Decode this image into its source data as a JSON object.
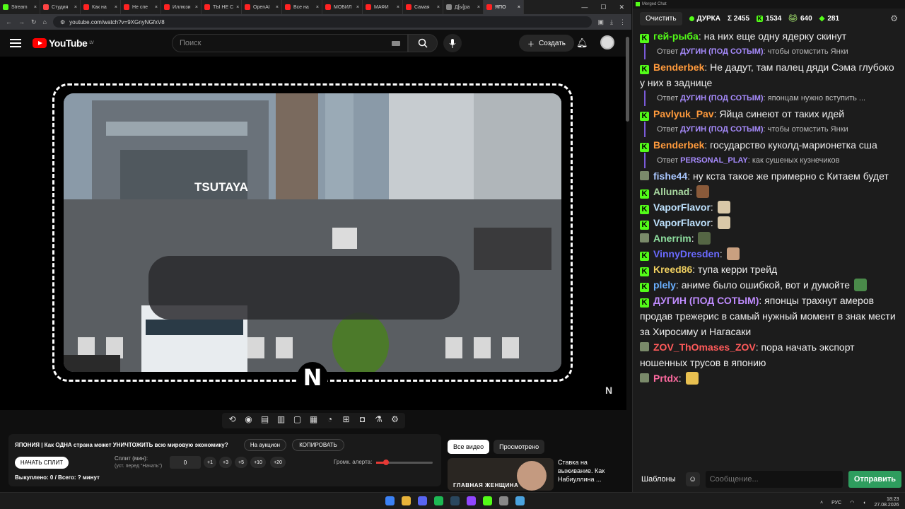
{
  "tabs": [
    {
      "label": "Stream",
      "color": "#53fc18"
    },
    {
      "label": "Студия",
      "color": "#ff4444"
    },
    {
      "label": "Как на",
      "color": "#ff2222"
    },
    {
      "label": "Не спе",
      "color": "#ff2222"
    },
    {
      "label": "Иллюзи",
      "color": "#ff2222"
    },
    {
      "label": "ТЫ НЕ С",
      "color": "#ff2222"
    },
    {
      "label": "OpenAI",
      "color": "#ff2222"
    },
    {
      "label": "Все на",
      "color": "#ff2222"
    },
    {
      "label": "МОБИЛ",
      "color": "#ff2222"
    },
    {
      "label": "МАФИ",
      "color": "#ff2222"
    },
    {
      "label": "Самая",
      "color": "#ff2222"
    },
    {
      "label": "Д[ы]ра",
      "color": "#888888"
    },
    {
      "label": "ЯПО",
      "color": "#ff2222"
    }
  ],
  "browser": {
    "url": "youtube.com/watch?v=9XGnyNGfxV8"
  },
  "youtube": {
    "logo": "YouTube",
    "region": "LV",
    "search_placeholder": "Поиск",
    "create_label": "Создать"
  },
  "player": {
    "channel_mark": "N"
  },
  "panel": {
    "title": "ЯПОНИЯ | Как ОДНА страна может УНИЧТОЖИТЬ всю мировую экономику?",
    "auction_label": "На аукцион",
    "copy_label": "КОПИРОВАТЬ",
    "start_split_label": "НАЧАТЬ СПЛИТ",
    "split_label": "Сплит (мин):",
    "split_hint": "(уст. перед \"Начать\")",
    "split_value": "0",
    "steps": [
      "+1",
      "+3",
      "+5",
      "+10",
      "+20"
    ],
    "volume_label": "Громк. алерта:",
    "volume_level": 0.17,
    "bought": "Выкуплено: 0 / Всего: ? минут"
  },
  "reco": {
    "tab_all": "Все видео",
    "tab_watched": "Просмотрено",
    "title": "Ставка на выживание. Как Набиуллина ...",
    "thumb_text": "ГЛАВНАЯ ЖЕНЩИНА"
  },
  "chat": {
    "window_title": "Merged Chat",
    "clear_label": "Очистить",
    "streamer": "ДУРКА",
    "total": "Σ 2455",
    "kick_count": "1534",
    "twitch_count": "640",
    "other_count": "281",
    "reply_prefix": "Ответ",
    "templates_label": "Шаблоны",
    "input_placeholder": "Сообщение...",
    "send_label": "Отправить",
    "messages": [
      {
        "type": "msg",
        "user": "гей-рыба",
        "color": "#53fc18",
        "text": "на них еще одну ядерку скинут"
      },
      {
        "type": "reply",
        "user": "ДУГИН (ПОД СОТЫМ)",
        "text": "чтобы отомстить Янки"
      },
      {
        "type": "msg",
        "user": "Benderbek",
        "color": "#ff9a3c",
        "text": "Не дадут, там палец дяди Сэма глубоко у них в заднице"
      },
      {
        "type": "reply",
        "user": "ДУГИН (ПОД СОТЫМ)",
        "text": "японцам нужно вступить ..."
      },
      {
        "type": "msg",
        "user": "Pavlyuk_Pav",
        "color": "#ff9a3c",
        "text": "Яйца синеют от таких идей"
      },
      {
        "type": "reply",
        "user": "ДУГИН (ПОД СОТЫМ)",
        "text": "чтобы отомстить Янки"
      },
      {
        "type": "msg",
        "user": "Benderbek",
        "color": "#ff9a3c",
        "text": "государство куколд-марионетка сша"
      },
      {
        "type": "reply",
        "user": "PERSONAL_PLAY",
        "text": "как сушеных кузнечиков"
      },
      {
        "type": "msg",
        "user": "fishe44",
        "color": "#a9c7ff",
        "text": "ну кста такое же примерно с Китаем будет",
        "img": true
      },
      {
        "type": "msg",
        "user": "Allunad",
        "color": "#a8d8a0",
        "text": "",
        "emote": "#8a5a3a"
      },
      {
        "type": "msg",
        "user": "VaporFlavor",
        "color": "#bfe3ff",
        "text": "",
        "emote": "#d9c8a8"
      },
      {
        "type": "msg",
        "user": "VaporFlavor",
        "color": "#bfe3ff",
        "text": "",
        "emote": "#d9c8a8"
      },
      {
        "type": "msg",
        "user": "Anerrim",
        "color": "#8fe0a0",
        "text": "",
        "emote": "#556644",
        "img": true
      },
      {
        "type": "msg",
        "user": "VinnyDresden",
        "color": "#6a6aff",
        "text": "",
        "emote": "#c9a080"
      },
      {
        "type": "msg",
        "user": "Kreed86",
        "color": "#f0d060",
        "text": "тупа керри трейд"
      },
      {
        "type": "msg",
        "user": "plely",
        "color": "#6ab0ff",
        "text": "аниме было ошибкой, вот и думойте",
        "emote_after": "#4a8a4a"
      },
      {
        "type": "msg",
        "user": "ДУГИН (ПОД СОТЫМ)",
        "color": "#c08cff",
        "text": "японцы трахнут амеров продав трежерис в самый нужный момент в знак мести за Хиросиму и Нагасаки"
      },
      {
        "type": "msg",
        "user": "ZOV_ThOmases_ZOV",
        "color": "#ff5a5a",
        "text": "пора начать экспорт ношенных трусов в японию",
        "img": true
      },
      {
        "type": "msg",
        "user": "Prtdx",
        "color": "#ff6aa0",
        "text": "",
        "emote": "#e8c050",
        "img": true
      }
    ]
  },
  "taskbar": {
    "lang": "РУС",
    "time": "18:23",
    "date": "27.08.2026"
  }
}
